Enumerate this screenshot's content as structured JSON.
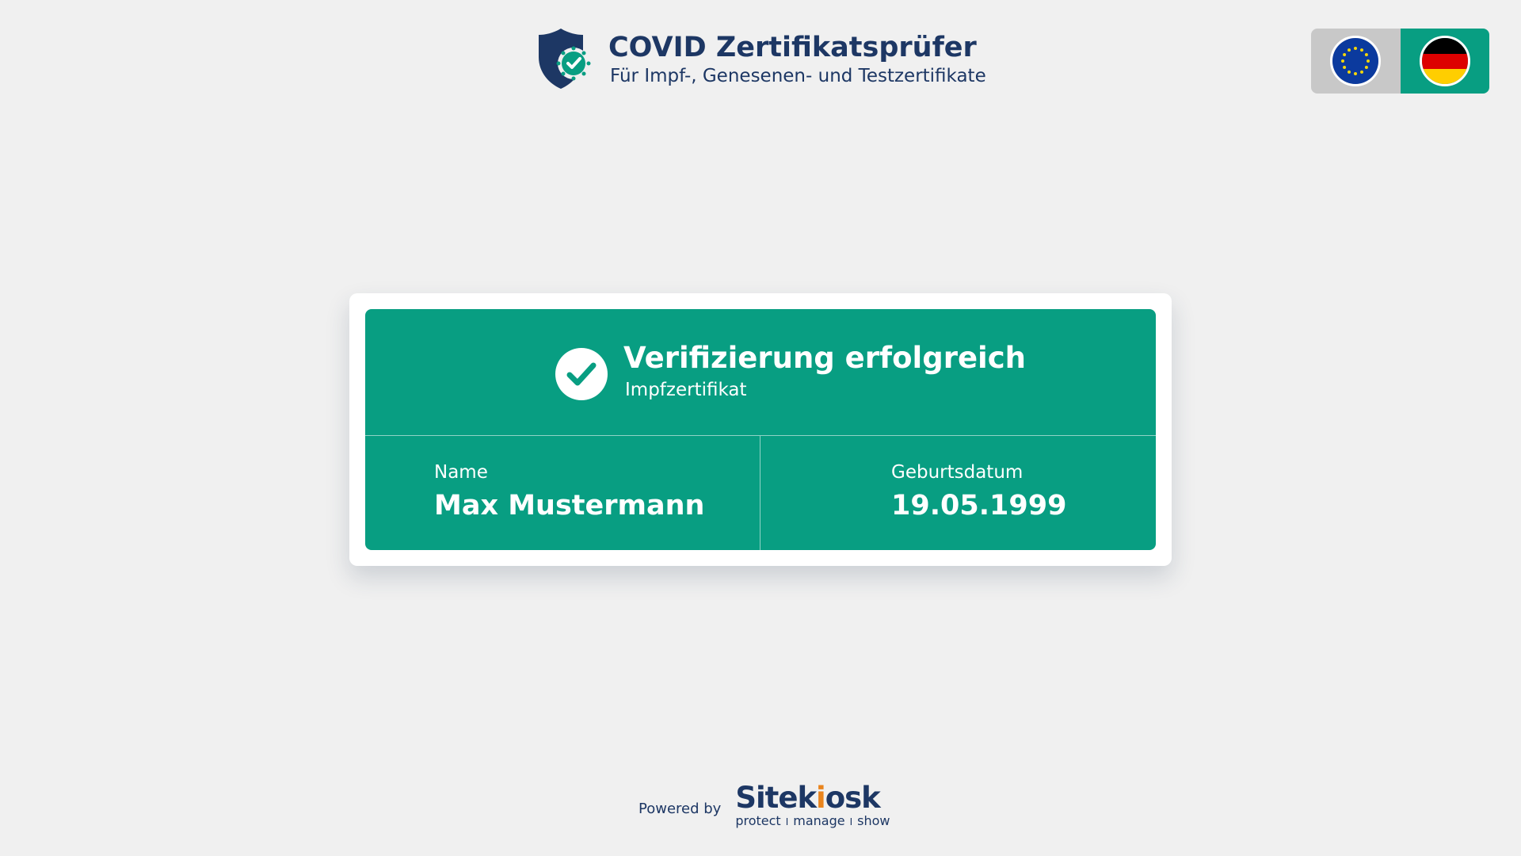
{
  "header": {
    "title": "COVID Zertifikatsprüfer",
    "subtitle": "Für Impf-, Genesenen- und Testzertifikate",
    "icon": "shield-check-icon"
  },
  "language_switch": {
    "options": [
      {
        "code": "EU",
        "icon": "eu-flag-icon",
        "selected": false
      },
      {
        "code": "DE",
        "icon": "german-flag-icon",
        "selected": true
      }
    ]
  },
  "result": {
    "status": "Verifizierung erfolgreich",
    "certificate_type": "Impfzertifikat",
    "icon": "check-circle-icon",
    "name_label": "Name",
    "name_value": "Max Mustermann",
    "dob_label": "Geburtsdatum",
    "dob_value": "19.05.1999"
  },
  "footer": {
    "powered_by": "Powered by",
    "brand_part1": "Sitek",
    "brand_part2": "i",
    "brand_part3": "osk",
    "tag1": "protect",
    "tag2": "manage",
    "tag3": "show",
    "separator": "I"
  },
  "colors": {
    "primary_navy": "#1d3764",
    "success_green": "#089e82",
    "background": "#f0f0f0",
    "brand_orange": "#e9841d"
  }
}
